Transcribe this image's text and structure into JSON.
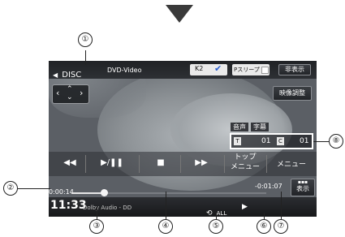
{
  "screen": {
    "source": "DISC",
    "mode": "DVD-Video",
    "k2_label": "K2",
    "sleep_label": "Pスリープ",
    "hide_label": "非表示",
    "adjust_label": "映像調整",
    "audio_tag": "音声",
    "subtitle_tag": "字幕",
    "title_tag": "T",
    "title_no": "01",
    "chapter_tag": "C",
    "chapter_no": "01",
    "top_menu_line1": "トップ",
    "top_menu_line2": "メニュー",
    "menu_label": "メニュー",
    "display_label": "表示",
    "elapsed": "0:00:14",
    "remaining": "-0:01:07",
    "progress_fraction": 0.17,
    "clock": "11:33",
    "audio_format": "Dolby Audio - DD",
    "repeat_label": "ALL"
  },
  "callouts": [
    "①",
    "②",
    "③",
    "④",
    "⑤",
    "⑥",
    "⑦",
    "⑧"
  ],
  "colors": {
    "accent": "#2a5fd1",
    "tag_bg": "#e8e8e8"
  }
}
